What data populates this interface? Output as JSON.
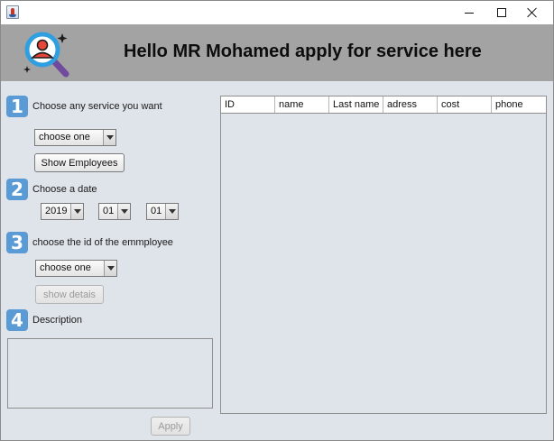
{
  "window": {
    "controls": {
      "minimize_icon": "minimize-icon",
      "maximize_icon": "maximize-icon",
      "close_icon": "close-icon"
    }
  },
  "header": {
    "title": "Hello MR Mohamed apply for service here",
    "logo_icon": "search-user-icon",
    "background": "#a3a3a3"
  },
  "steps": {
    "step1": {
      "number": "1",
      "label": "Choose any service you want",
      "service_select": {
        "value": "choose one"
      },
      "show_employees_label": "Show Employees"
    },
    "step2": {
      "number": "2",
      "label": "Choose a date",
      "year": "2019",
      "month": "01",
      "day": "01"
    },
    "step3": {
      "number": "3",
      "label": "choose the id of the emmployee",
      "employee_select": {
        "value": "choose one"
      },
      "show_details_label": "show detais"
    },
    "step4": {
      "number": "4",
      "label": "Description",
      "description_value": ""
    }
  },
  "apply_label": "Apply",
  "table": {
    "columns": [
      "ID",
      "name",
      "Last name",
      "adress",
      "cost",
      "phone"
    ],
    "rows": []
  },
  "colors": {
    "badge": "#5b9bd5",
    "panel": "#dfe3ea",
    "header": "#a3a3a3"
  }
}
